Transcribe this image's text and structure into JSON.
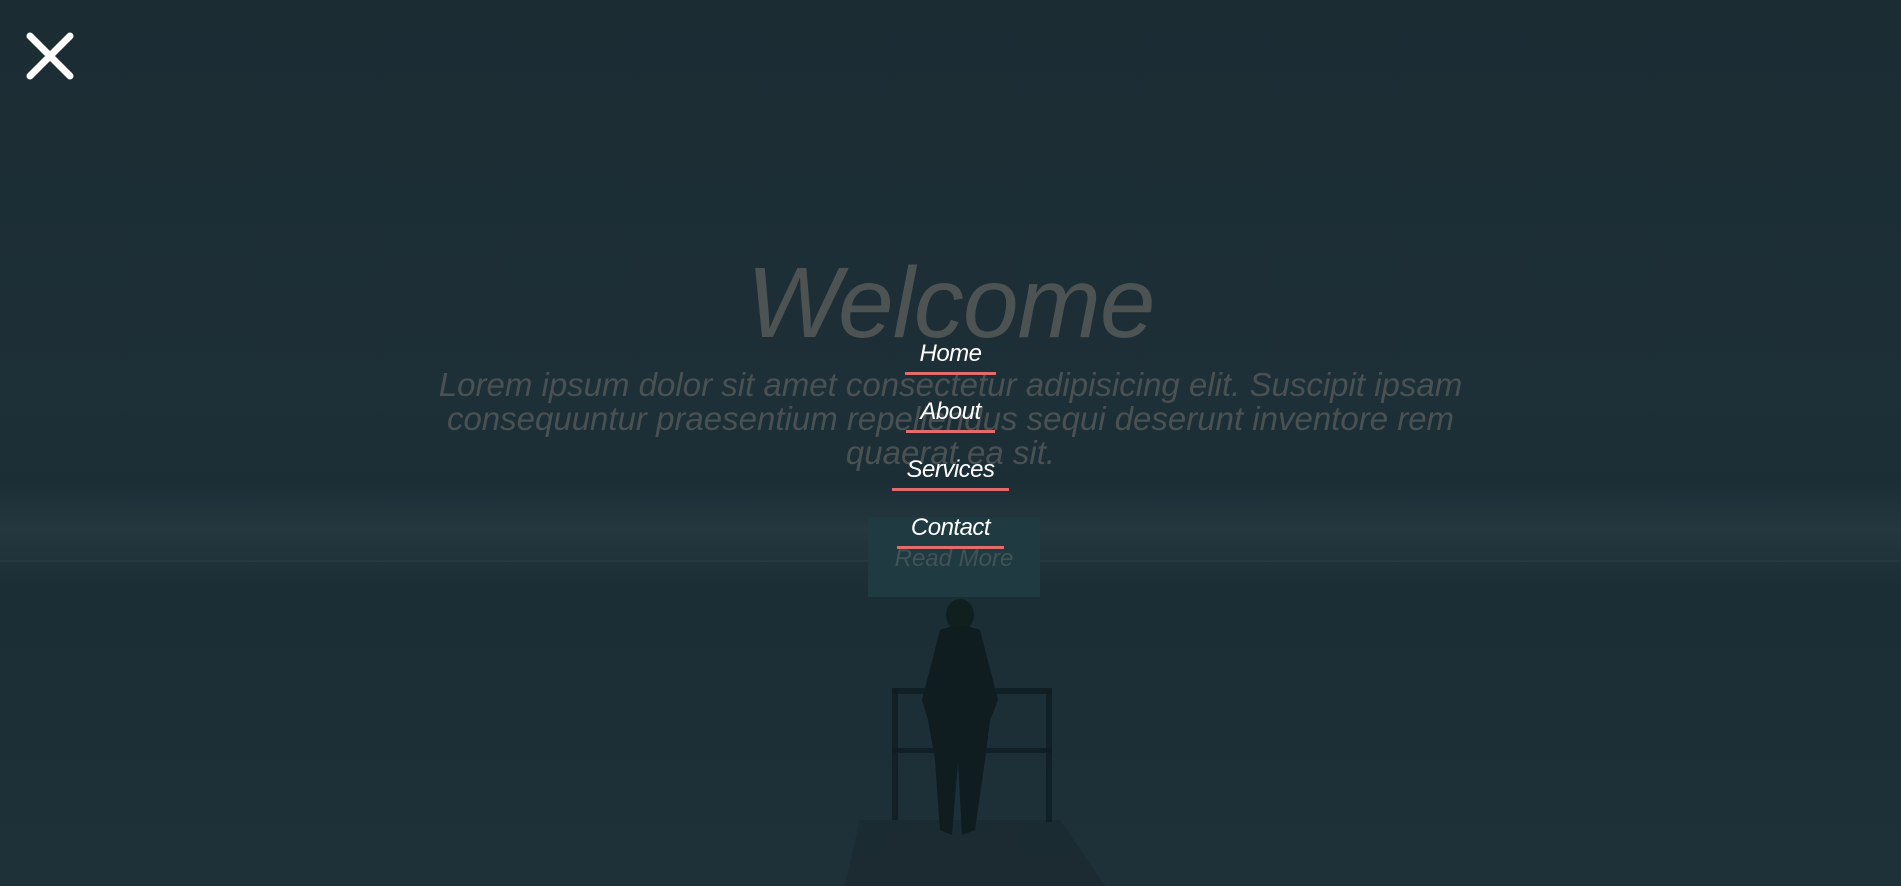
{
  "hero": {
    "title": "Welcome",
    "text": "Lorem ipsum dolor sit amet consectetur adipisicing elit. Suscipit ipsam consequuntur praesentium repellendus sequi deserunt inventore rem quaerat ea sit.",
    "button_label": "Read More"
  },
  "nav": {
    "items": [
      {
        "label": "Home"
      },
      {
        "label": "About"
      },
      {
        "label": "Services"
      },
      {
        "label": "Contact"
      }
    ]
  },
  "icons": {
    "close": "close-icon"
  },
  "colors": {
    "overlay_bg": "#1d2f37",
    "nav_text": "#ffffff",
    "nav_underline": "#e26c6c",
    "close_icon": "#ffffff"
  }
}
